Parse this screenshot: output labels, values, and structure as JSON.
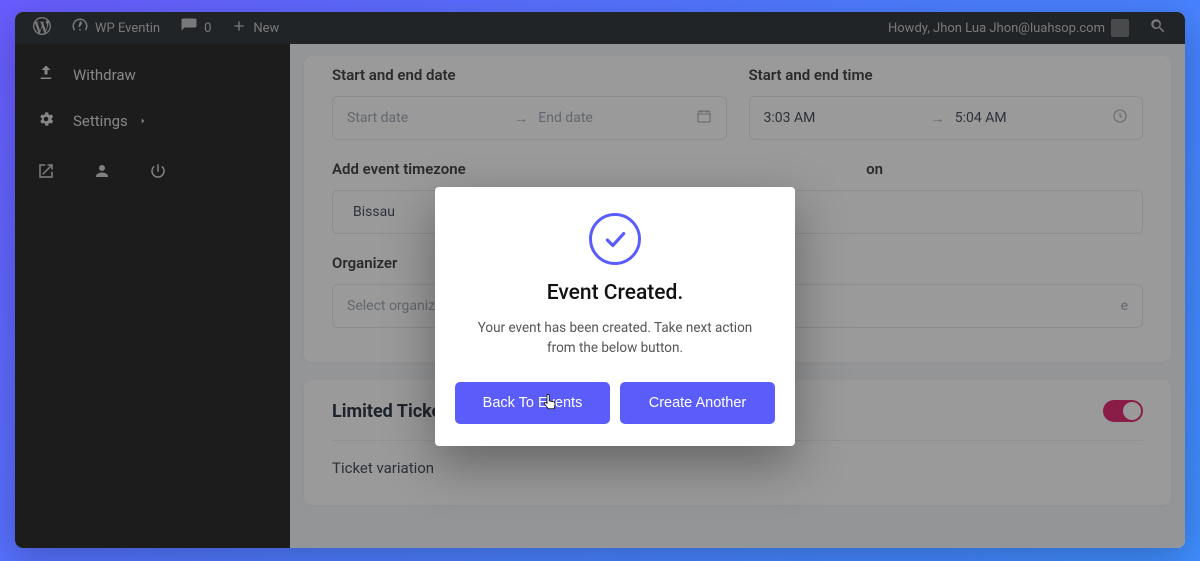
{
  "adminbar": {
    "site_title": "WP Eventin",
    "comments_count": "0",
    "new_label": "New",
    "howdy": "Howdy, Jhon Lua Jhon@luahsop.com"
  },
  "sidebar": {
    "items": [
      {
        "label": "Withdraw"
      },
      {
        "label": "Settings"
      }
    ]
  },
  "form": {
    "date_label": "Start and end date",
    "start_date_placeholder": "Start date",
    "end_date_placeholder": "End date",
    "time_label": "Start and end time",
    "start_time": "3:03 AM",
    "end_time": "5:04 AM",
    "timezone_label": "Add event timezone",
    "timezone_value": "Bissau",
    "location_label_partial": "on",
    "organizer_label": "Organizer",
    "organizer_placeholder": "Select organizer",
    "organizer_right_partial": "e"
  },
  "tickets": {
    "limited_label": "Limited Tickets",
    "variation_label": "Ticket variation",
    "toggle_on": true
  },
  "modal": {
    "title": "Event Created.",
    "body": "Your event has been created. Take next action from the below button.",
    "back_btn": "Back To Events",
    "create_btn": "Create Another"
  }
}
